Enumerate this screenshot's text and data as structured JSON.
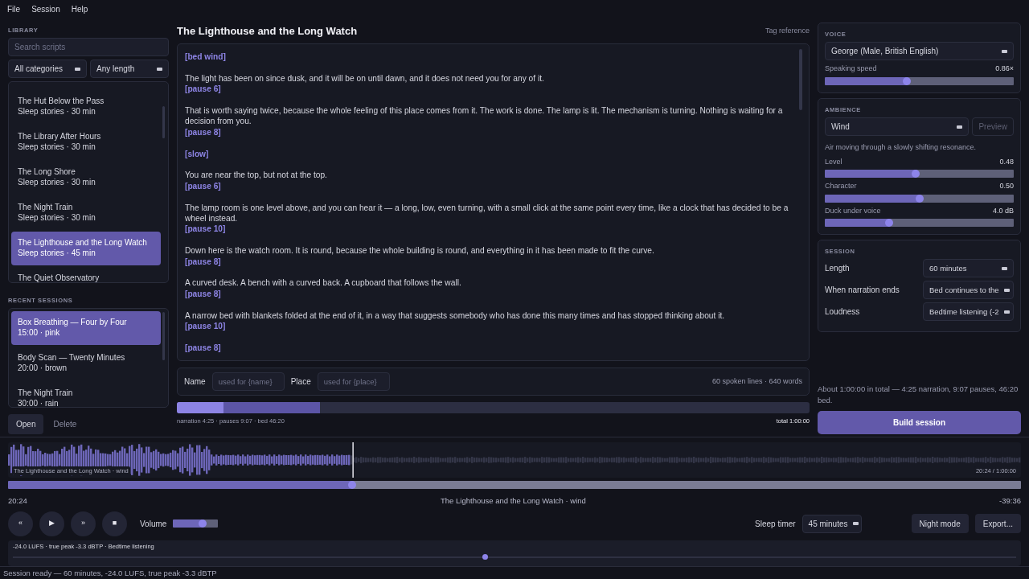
{
  "menu": [
    "File",
    "Session",
    "Help"
  ],
  "library": {
    "heading": "LIBRARY",
    "search": {
      "placeholder": "Search scripts"
    },
    "filters": [
      {
        "value": "All categories"
      },
      {
        "value": "Any length"
      }
    ],
    "items": [
      {
        "title": "The Hut Below the Pass",
        "meta": "Sleep stories · 30 min",
        "selected": false
      },
      {
        "title": "The Library After Hours",
        "meta": "Sleep stories · 30 min",
        "selected": false
      },
      {
        "title": "The Long Shore",
        "meta": "Sleep stories · 30 min",
        "selected": false
      },
      {
        "title": "The Night Train",
        "meta": "Sleep stories · 30 min",
        "selected": false
      },
      {
        "title": "The Lighthouse and the Long Watch",
        "meta": "Sleep stories · 45 min",
        "selected": true
      },
      {
        "title": "The Quiet Observatory",
        "selected": false
      }
    ]
  },
  "recent": {
    "heading": "RECENT SESSIONS",
    "items": [
      {
        "title": "Box Breathing — Four by Four",
        "meta": "15:00 · pink",
        "selected": true
      },
      {
        "title": "Body Scan — Twenty Minutes",
        "meta": "20:00 · brown",
        "selected": false
      },
      {
        "title": "The Night Train",
        "meta": "30:00 · rain",
        "selected": false
      }
    ],
    "buttons": [
      {
        "label": "Open",
        "kind": "secondary"
      },
      {
        "label": "Delete",
        "kind": "plain"
      }
    ]
  },
  "script": {
    "title": "The Lighthouse and the Long Watch",
    "link": "Tag reference",
    "blocks": [
      [
        {
          "kind": "tag",
          "text": "[bed wind]"
        }
      ],
      [
        {
          "kind": "text",
          "text": "The light has been on since dusk, and it will be on until dawn, and it does not need you for any of it."
        },
        {
          "kind": "tag",
          "text": "[pause 6]"
        }
      ],
      [
        {
          "kind": "text",
          "text": "That is worth saying twice, because the whole feeling of this place comes from it. The work is done. The lamp is lit. The mechanism is turning. Nothing is waiting for a decision from you."
        },
        {
          "kind": "tag",
          "text": "[pause 8]"
        }
      ],
      [
        {
          "kind": "tag",
          "text": "[slow]"
        }
      ],
      [
        {
          "kind": "text",
          "text": "You are near the top, but not at the top."
        },
        {
          "kind": "tag",
          "text": "[pause 6]"
        }
      ],
      [
        {
          "kind": "text",
          "text": "The lamp room is one level above, and you can hear it — a long, low, even turning, with a small click at the same point every time, like a clock that has decided to be a wheel instead."
        },
        {
          "kind": "tag",
          "text": "[pause 10]"
        }
      ],
      [
        {
          "kind": "text",
          "text": "Down here is the watch room. It is round, because the whole building is round, and everything in it has been made to fit the curve."
        },
        {
          "kind": "tag",
          "text": "[pause 8]"
        }
      ],
      [
        {
          "kind": "text",
          "text": "A curved desk. A bench with a curved back. A cupboard that follows the wall."
        },
        {
          "kind": "tag",
          "text": "[pause 8]"
        }
      ],
      [
        {
          "kind": "text",
          "text": "A narrow bed with blankets folded at the end of it, in a way that suggests somebody who has done this many times and has stopped thinking about it."
        },
        {
          "kind": "tag",
          "text": "[pause 10]"
        }
      ],
      [
        {
          "kind": "tag",
          "text": "[pause 8]"
        }
      ]
    ],
    "fields": [
      {
        "label": "Name",
        "placeholder": "used for {name}"
      },
      {
        "label": "Place",
        "placeholder": "used for {place}"
      }
    ],
    "stats": "60 spoken lines · 640 words"
  },
  "timeline": {
    "segments": [
      {
        "kind": "narration",
        "level": 0.074
      },
      {
        "kind": "pauses",
        "level": 0.226
      }
    ],
    "legend": "narration 4:25 · pauses 9:07 · bed 46:20",
    "total": "total 1:00:00"
  },
  "voice": {
    "heading": "VOICE",
    "select": "George (Male, British English)",
    "sliders": [
      {
        "label": "Speaking speed",
        "reading": "0.86×",
        "level": 0.435
      }
    ]
  },
  "ambience": {
    "heading": "AMBIENCE",
    "select": "Wind",
    "preview": {
      "label": "Preview",
      "disabled": true
    },
    "description": "Air moving through a slowly shifting resonance.",
    "sliders": [
      {
        "label": "Level",
        "reading": "0.48",
        "level": 0.48
      },
      {
        "label": "Character",
        "reading": "0.50",
        "level": 0.5
      },
      {
        "label": "Duck under voice",
        "reading": "4.0 dB",
        "level": 0.34
      }
    ]
  },
  "session": {
    "heading": "SESSION",
    "rows": [
      {
        "label": "Length",
        "value": "60 minutes"
      },
      {
        "label": "When narration ends",
        "value": "Bed continues to the"
      },
      {
        "label": "Loudness",
        "value": "Bedtime listening  (-2"
      }
    ]
  },
  "summary": "About 1:00:00 in total — 4:25 narration, 9:07 pauses, 46:20 bed.",
  "build": "Build session",
  "player": {
    "waveform": {
      "level": 0.34,
      "caption": "The Lighthouse and the Long Watch · wind",
      "time": "20:24 / 1:00:00"
    },
    "seek": {
      "level": 0.34
    },
    "elapsed": "20:24",
    "now_playing": "The Lighthouse and the Long Watch · wind",
    "remaining": "-39:36",
    "transport": [
      {
        "glyph": "«"
      },
      {
        "glyph": "▶"
      },
      {
        "glyph": "»"
      },
      {
        "glyph": "■"
      }
    ],
    "volume": {
      "label": "Volume",
      "level": 0.66
    },
    "sleep_timer": {
      "label": "Sleep timer",
      "value": "45 minutes"
    },
    "buttons": [
      "Night mode",
      "Export..."
    ],
    "meter": {
      "text": "-24.0 LUFS  ·  true peak -3.3 dBTP  ·  Bedtime listening",
      "level": 0.47
    }
  },
  "status_bar": "Session ready — 60 minutes, -24.0 LUFS, true peak -3.3 dBTP"
}
